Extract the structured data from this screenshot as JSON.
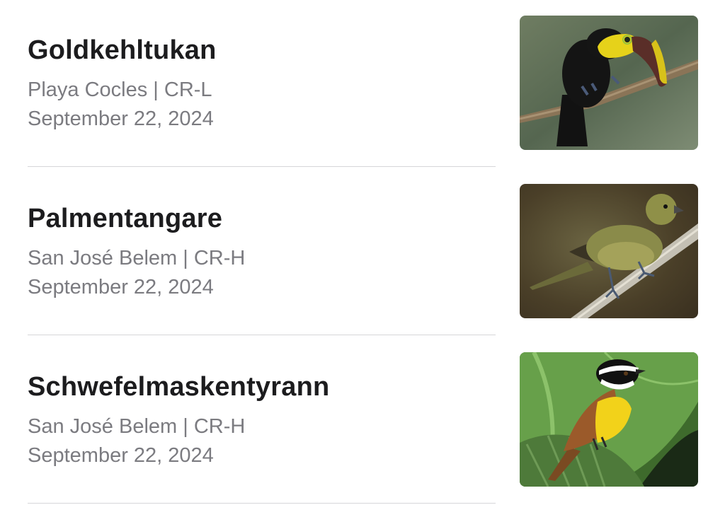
{
  "sightings": [
    {
      "species": "Goldkehltukan",
      "location": "Playa Cocles | CR-L",
      "date": "September 22, 2024",
      "photo_icon": "toucan-photo"
    },
    {
      "species": "Palmentangare",
      "location": "San José Belem | CR-H",
      "date": "September 22, 2024",
      "photo_icon": "tanager-photo"
    },
    {
      "species": "Schwefelmaskentyrann",
      "location": "San José Belem | CR-H",
      "date": "September 22, 2024",
      "photo_icon": "kiskadee-photo"
    }
  ],
  "colors": {
    "title": "#1c1c1e",
    "secondary_text": "#7b7b80",
    "divider": "#d6d6d9"
  }
}
